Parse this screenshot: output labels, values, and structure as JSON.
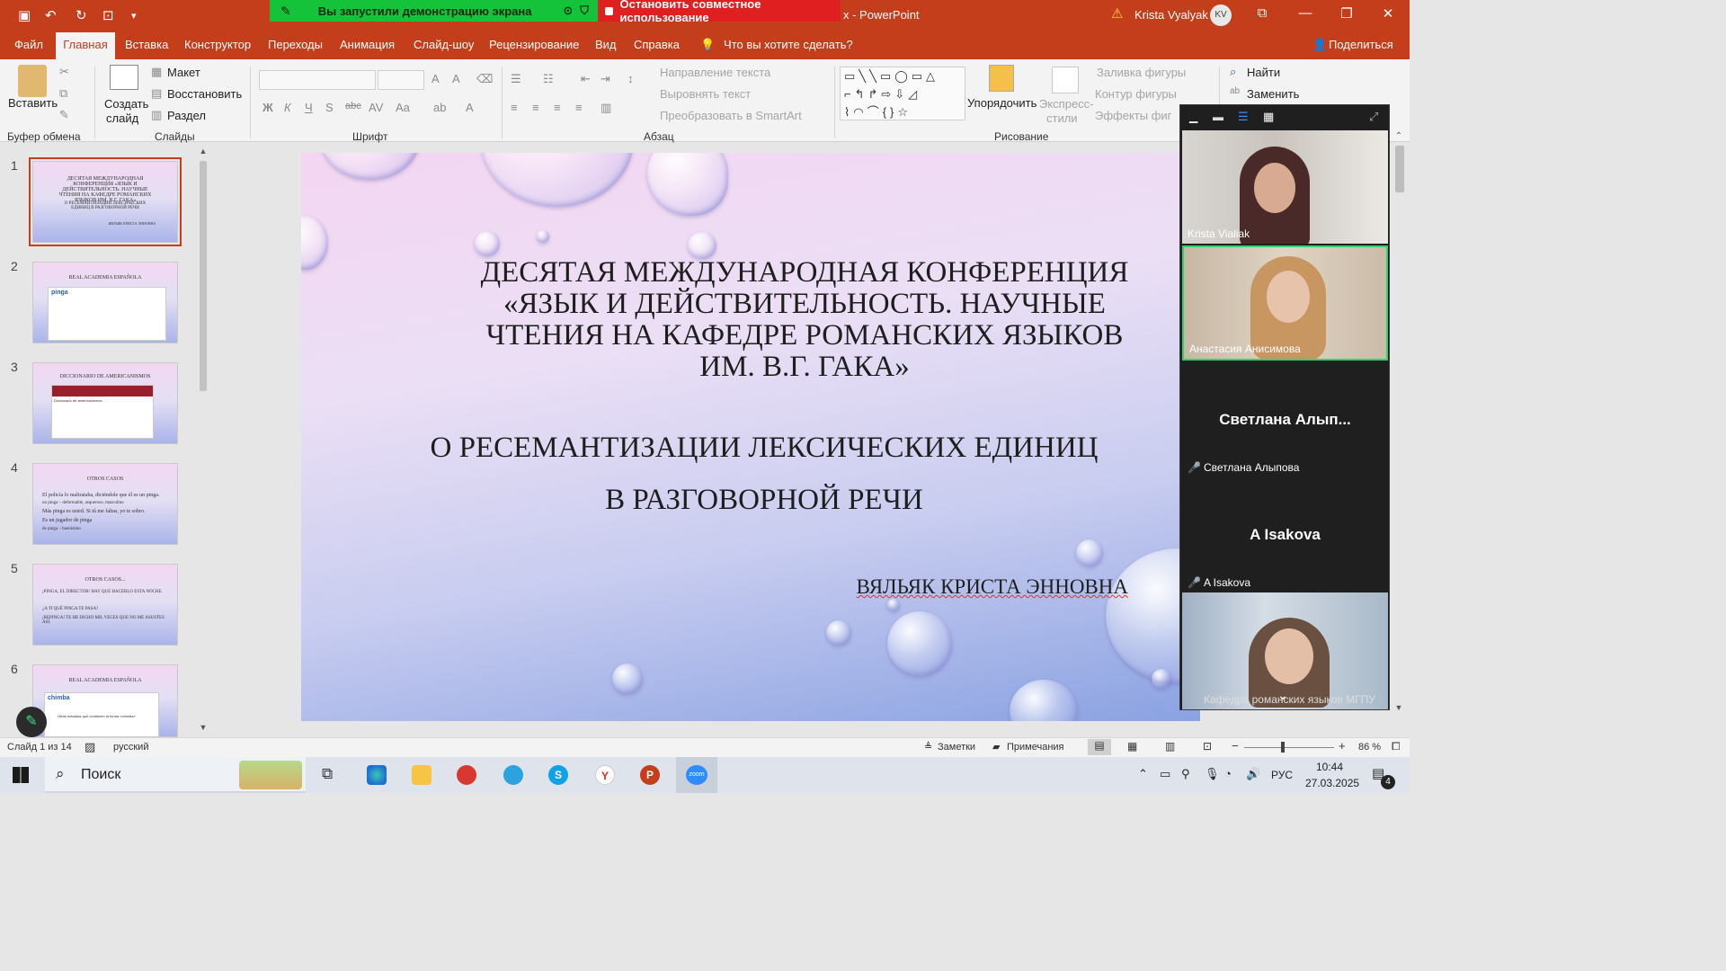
{
  "window": {
    "doc_suffix": "x - PowerPoint",
    "user": "Krista Vyalyak",
    "avatar": "KV",
    "share_banner": "Вы запустили демонстрацию экрана",
    "stop_share": "Остановить совместное использование"
  },
  "menu": {
    "file": "Файл",
    "home": "Главная",
    "insert": "Вставка",
    "design": "Конструктор",
    "transitions": "Переходы",
    "animation": "Анимация",
    "slideshow": "Слайд-шоу",
    "review": "Рецензирование",
    "view": "Вид",
    "help": "Справка",
    "tell_me": "Что вы хотите сделать?",
    "share": "Поделиться"
  },
  "ribbon": {
    "paste": "Вставить",
    "clipboard": "Буфер обмена",
    "new_slide_1": "Создать",
    "new_slide_2": "слайд",
    "layout": "Макет",
    "reset": "Восстановить",
    "section": "Раздел",
    "slides": "Слайды",
    "font": "Шрифт",
    "text_direction": "Направление текста",
    "align_text": "Выровнять текст",
    "smartart": "Преобразовать в SmartArt",
    "paragraph": "Абзац",
    "arrange": "Упорядочить",
    "quick_styles_1": "Экспресс-",
    "quick_styles_2": "стили",
    "shape_fill": "Заливка фигуры",
    "shape_outline": "Контур фигуры",
    "shape_effects": "Эффекты фиг",
    "drawing": "Рисование",
    "find": "Найти",
    "replace": "Заменить"
  },
  "thumbnails": [
    {
      "num": "1",
      "title": "ДЕСЯТАЯ МЕЖДУНАРОДНАЯ КОНФЕРЕНЦИЯ «ЯЗЫК И ДЕЙСТВИТЕЛЬНОСТЬ. НАУЧНЫЕ ЧТЕНИЯ НА КАФЕДРЕ РОМАНСКИХ ЯЗЫКОВ ИМ. В.Г. ГАКА»",
      "sub": "О РЕСЕМАНТИЗАЦИИ ЛЕКСИЧЕСКИХ ЕДИНИЦ В РАЗГОВОРНОЙ РЕЧИ",
      "author": "ВЯЛЬЯК КРИСТА ЭННОВНА"
    },
    {
      "num": "2",
      "title": "REAL ACADEMIA ESPAÑOLA",
      "word": "pinga"
    },
    {
      "num": "3",
      "title": "DICCIONARIO DE AMERICANISMOS",
      "card_title": "Diccionario de americanismos"
    },
    {
      "num": "4",
      "title": "OTROS CASOS",
      "lines": [
        "El policía lo maltrataba, diciéndole que él es un pinga.",
        "un pinga – deformable, asqueroso, masculino",
        "Más pinga es usted. Si tú me faltas, yo te sobro.",
        "Es un jugador de pinga",
        "de pinga – buenísimo"
      ]
    },
    {
      "num": "5",
      "title": "OTROS CASOS...",
      "lines": [
        "¡PINGA, EL DIRECTOR! HAY QUE HACERLO ESTA NOCHE.",
        "¿A TI QUÉ PINGA TE PASA?",
        "¡REPINGA! TE HE DICHO MIL VECES QUE NO ME ASUSTES ASÍ."
      ]
    },
    {
      "num": "6",
      "title": "REAL ACADEMIA ESPAÑOLA",
      "word": "chimba",
      "card_line": "Otras entradas que contienen la forma «chimba»"
    }
  ],
  "slide": {
    "title_lines": [
      "ДЕСЯТАЯ МЕЖДУНАРОДНАЯ КОНФЕРЕНЦИЯ",
      "«ЯЗЫК И ДЕЙСТВИТЕЛЬНОСТЬ. НАУЧНЫЕ",
      "ЧТЕНИЯ НА КАФЕДРЕ РОМАНСКИХ ЯЗЫКОВ",
      "ИМ. В.Г. ГАКА»"
    ],
    "subtitle_1": "О РЕСЕМАНТИЗАЦИИ ЛЕКСИЧЕСКИХ ЕДИНИЦ",
    "subtitle_2": "В РАЗГОВОРНОЙ РЕЧИ",
    "author": "ВЯЛЬЯК КРИСТА ЭННОВНА"
  },
  "zoom": {
    "participants": [
      {
        "name": "Krista Vialiak",
        "video": true
      },
      {
        "name": "Анастасия Анисимова",
        "video": true,
        "active_speaker": true
      },
      {
        "display": "Светлана  Алып...",
        "name": "Светлана Алыпова",
        "muted": true
      },
      {
        "display": "A Isakova",
        "name": "A Isakova",
        "muted": true
      },
      {
        "name": "Кафедра романских языков МГПУ",
        "video": true
      }
    ]
  },
  "status": {
    "slide_counter": "Слайд 1 из 14",
    "language": "русский",
    "notes": "Заметки",
    "comments": "Примечания",
    "zoom": "86 %"
  },
  "taskbar": {
    "search": "Поиск",
    "lang": "РУС",
    "time": "10:44",
    "date": "27.03.2025",
    "notifications": "4"
  }
}
